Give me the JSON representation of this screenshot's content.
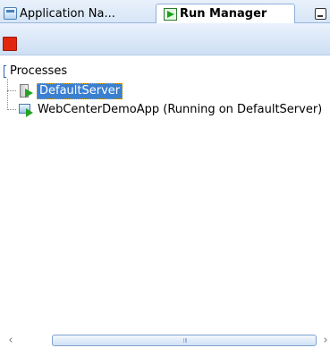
{
  "tabs": [
    {
      "label": "Application Na...",
      "icon": "application-navigator-icon",
      "active": false
    },
    {
      "label": "Run Manager",
      "icon": "run-manager-icon",
      "active": true
    },
    {
      "label": "",
      "icon": "minimize-icon",
      "active": false
    }
  ],
  "toolbar": {
    "stop_icon": "stop-icon",
    "stop_color": "#e2260e"
  },
  "tree": {
    "root_label": "Processes",
    "items": [
      {
        "label": "DefaultServer",
        "icon": "server-run-icon",
        "selected": true
      },
      {
        "label": "WebCenterDemoApp (Running on DefaultServer)",
        "icon": "deployed-app-icon",
        "selected": false
      }
    ]
  },
  "colors": {
    "selection": "#3a7fd0",
    "tab_bar": "#d7e6f7",
    "run_green": "#22a322"
  }
}
